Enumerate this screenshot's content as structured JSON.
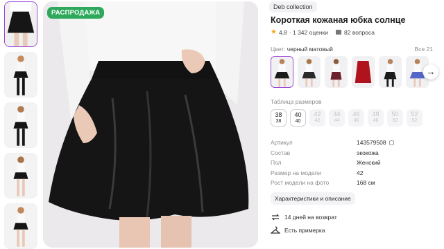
{
  "badge": {
    "sale": "РАСПРОДАЖА"
  },
  "product": {
    "brand": "Deb collection",
    "title": "Короткая кожаная юбка солнце",
    "rating": "4,8",
    "reviews": "· 1 342 оценки",
    "questions": "82 вопроса"
  },
  "colors": {
    "label": "Цвет:",
    "value": "черный матовый",
    "all": "Все 21",
    "swatch_colors": [
      "#1b1b1b",
      "#2a2a2a",
      "#6b1f2b",
      "#b0121e",
      "#1b1b1b",
      "#5466c7"
    ]
  },
  "sizes": {
    "table_label": "Таблица размеров",
    "items": [
      {
        "top": "38",
        "bottom": "38",
        "available": true
      },
      {
        "top": "40",
        "bottom": "40",
        "available": true
      },
      {
        "top": "42",
        "bottom": "42",
        "available": false
      },
      {
        "top": "44",
        "bottom": "44",
        "available": false
      },
      {
        "top": "46",
        "bottom": "46",
        "available": false
      },
      {
        "top": "48",
        "bottom": "48",
        "available": false
      },
      {
        "top": "50",
        "bottom": "50",
        "available": false
      },
      {
        "top": "52",
        "bottom": "52",
        "available": false
      }
    ]
  },
  "specs": [
    {
      "key": "Артикул",
      "value": "143579508"
    },
    {
      "key": "Состав",
      "value": "экокожа"
    },
    {
      "key": "Пол",
      "value": "Женский"
    },
    {
      "key": "Размер на модели",
      "value": "42"
    },
    {
      "key": "Рост модели на фото",
      "value": "168 см"
    }
  ],
  "buttons": {
    "characteristics": "Характеристики и описание"
  },
  "features": {
    "return": "14 дней на возврат",
    "fitting": "Есть примерка"
  },
  "accent_color": "#9b49d8"
}
